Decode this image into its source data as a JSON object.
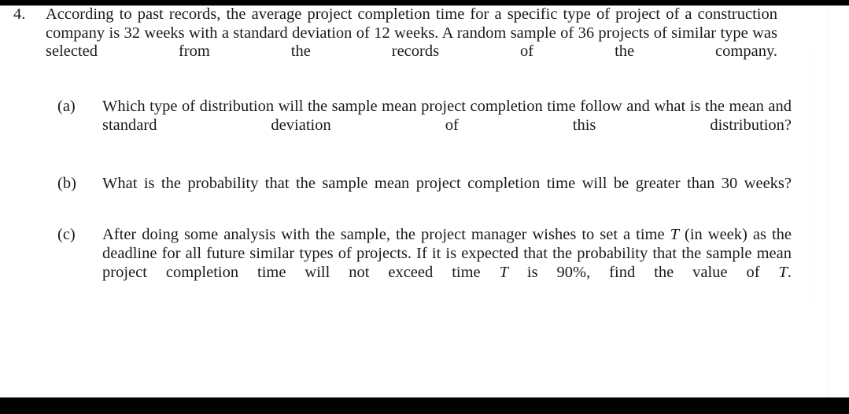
{
  "document": {
    "type": "scanned-exam-question",
    "background_color": "#fdfdfd",
    "border_color": "#010101",
    "text_color": "#1d1d1d"
  },
  "question": {
    "number": "4.",
    "stem": "According to past records, the average project completion time for a specific type of project of a construction company is 32 weeks with a standard deviation of 12 weeks. A random sample of 36 projects of similar type was selected from the records of the company.",
    "given_values": {
      "population_mean_weeks": 32,
      "population_std_dev_weeks": 12,
      "sample_size": 36
    },
    "parts": [
      {
        "label": "(a)",
        "text": "Which type of distribution will the sample mean project completion time follow and what is the mean and standard deviation of this distribution?"
      },
      {
        "label": "(b)",
        "text": "What is the probability that the sample mean project completion time will be greater than 30 weeks?",
        "threshold_weeks": 30
      },
      {
        "label": "(c)",
        "text_run_1": "After doing some analysis with the sample, the project manager wishes to set a time ",
        "variable_1": "T",
        "text_run_2": " (in week) as the deadline for all future similar types of projects. If it is expected that the probability that the sample mean project completion time will not exceed time ",
        "variable_2": "T",
        "text_run_3": " is 90%, find the value of ",
        "variable_3": "T",
        "text_run_4": ".",
        "probability_percent": "90%"
      }
    ]
  }
}
